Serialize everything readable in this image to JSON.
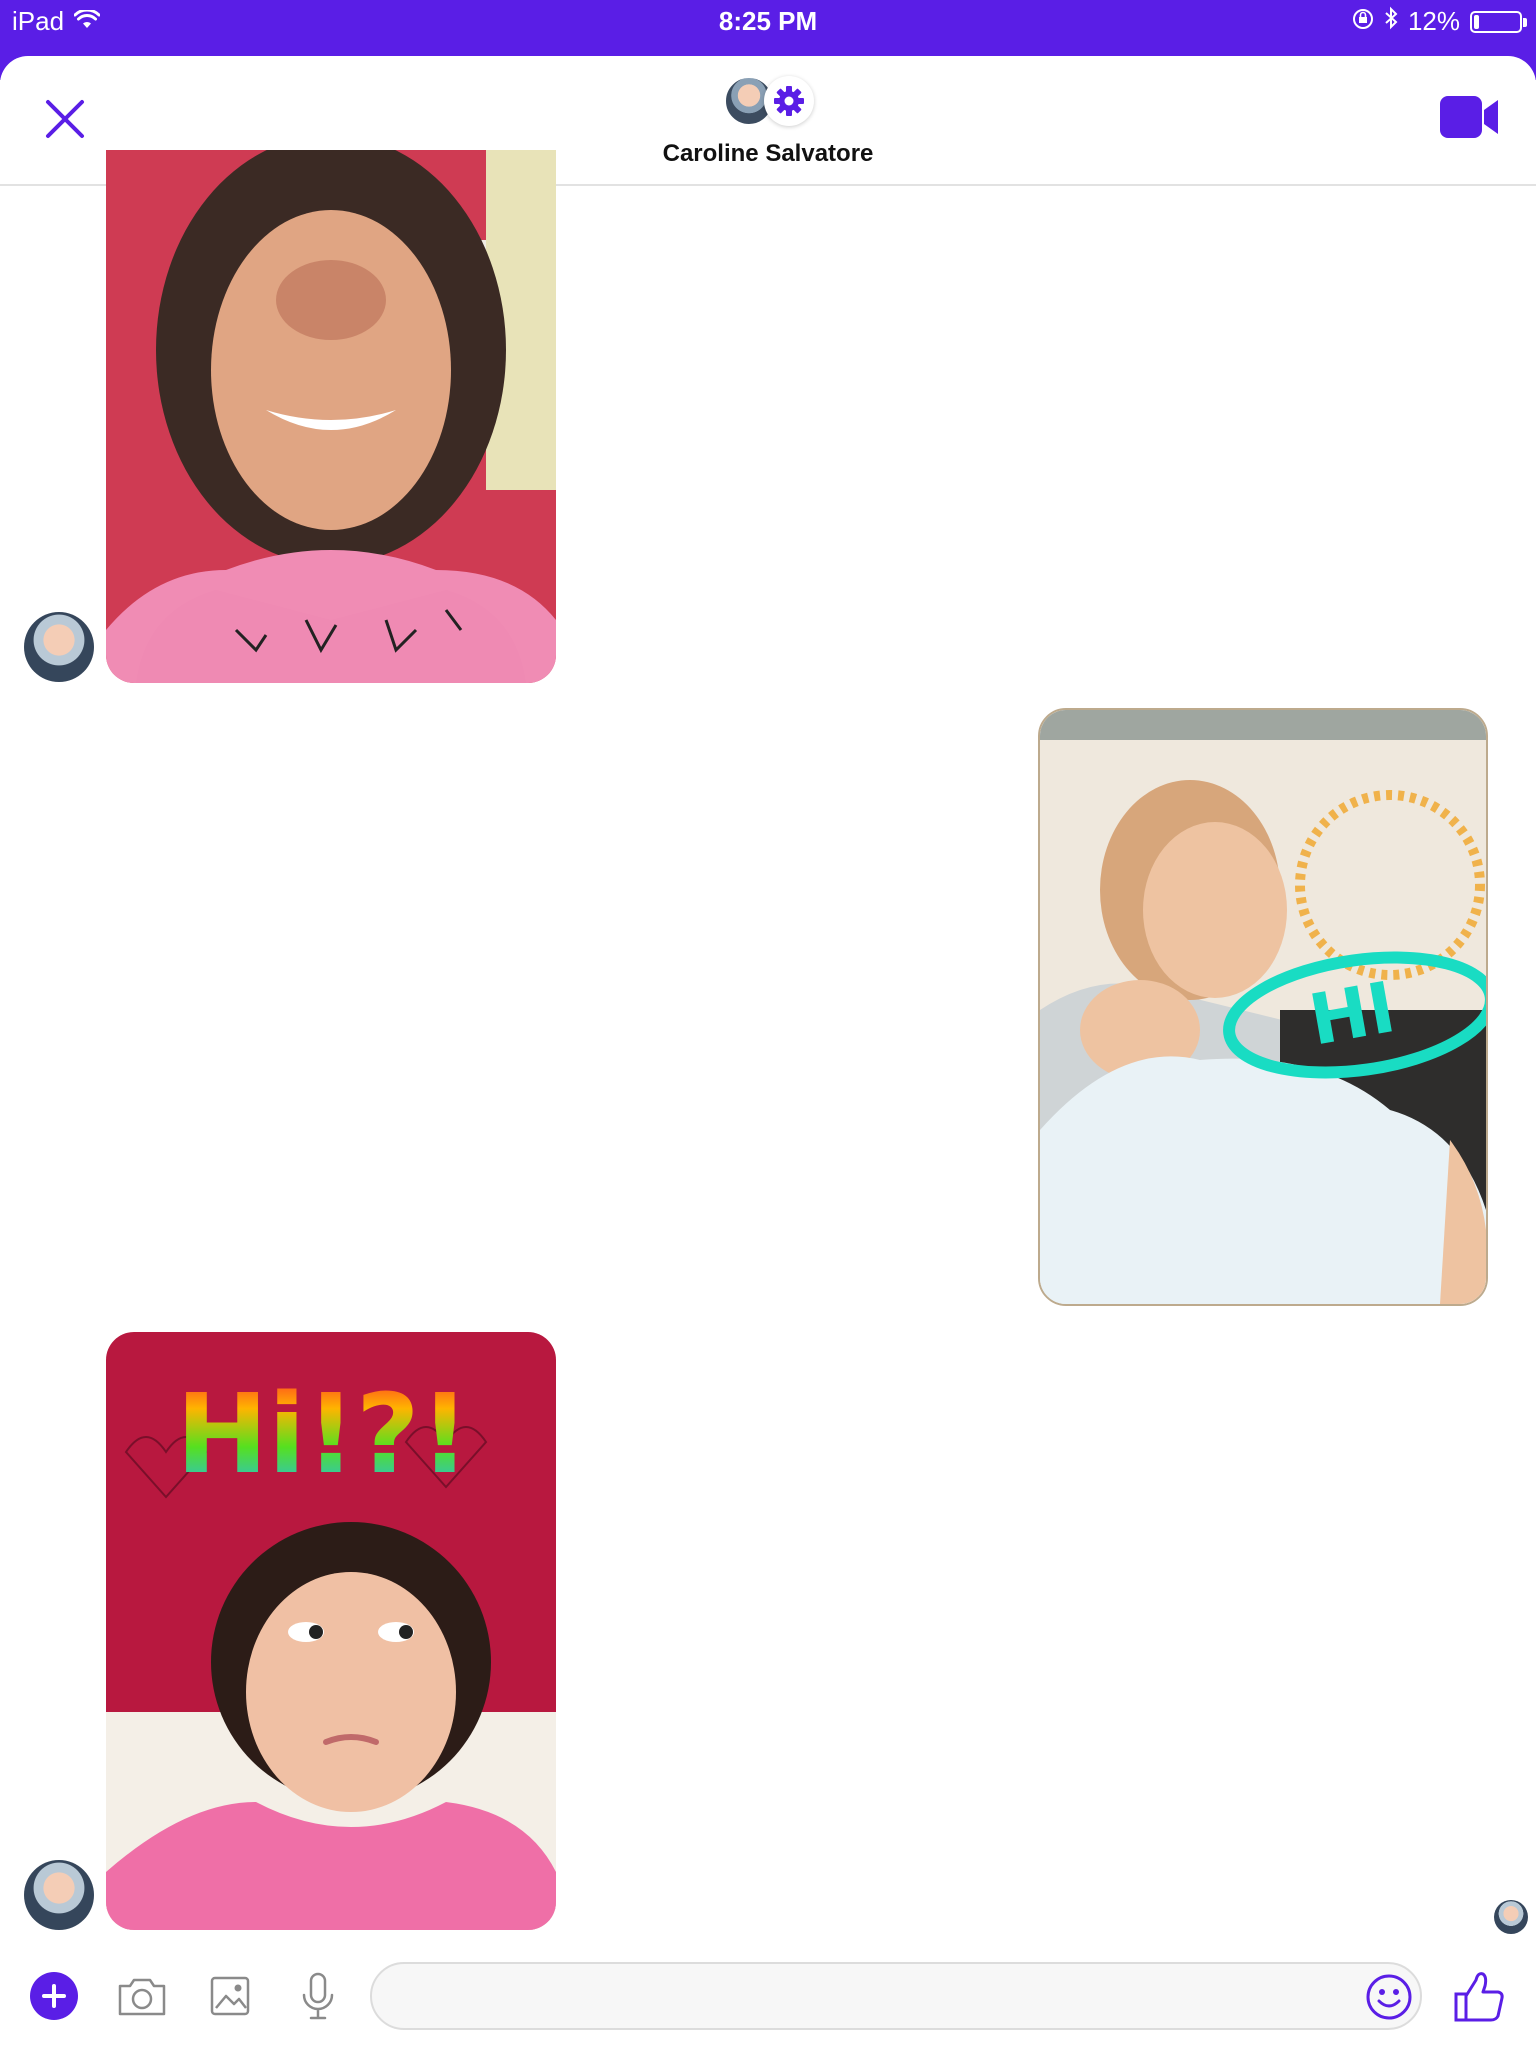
{
  "status_bar": {
    "device": "iPad",
    "time": "8:25 PM",
    "battery": "12%",
    "battery_level": 0.12
  },
  "header": {
    "contact_name": "Caroline Salvatore"
  },
  "messages": [
    {
      "sender": "contact",
      "type": "photo",
      "overlay_text": ""
    },
    {
      "sender": "self",
      "type": "photo",
      "overlay_text": "HI"
    },
    {
      "sender": "contact",
      "type": "photo",
      "overlay_text": "Hi!?!"
    }
  ],
  "composer": {
    "placeholder": "",
    "value": ""
  },
  "colors": {
    "accent": "#5a1ee6",
    "status_bar": "#5a1ee6"
  },
  "icons": [
    "close-icon",
    "gear-icon",
    "video-call-icon",
    "plus-icon",
    "camera-icon",
    "gallery-icon",
    "microphone-icon",
    "emoji-icon",
    "thumbs-up-icon",
    "wifi-icon",
    "bluetooth-icon",
    "orientation-lock-icon",
    "battery-icon"
  ]
}
